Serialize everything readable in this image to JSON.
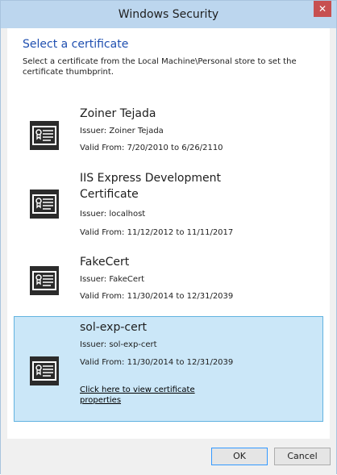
{
  "window": {
    "title": "Windows Security",
    "close_label": "✕"
  },
  "header": {
    "title": "Select a certificate",
    "description": "Select a certificate from the Local Machine\\Personal store to set the certificate thumbprint."
  },
  "certificates": [
    {
      "name": "Zoiner Tejada",
      "issuer": "Issuer: Zoiner Tejada",
      "valid": "Valid From: 7/20/2010 to 6/26/2110",
      "selected": false
    },
    {
      "name": "IIS Express Development Certificate",
      "issuer": "Issuer: localhost",
      "valid": "Valid From: 11/12/2012 to 11/11/2017",
      "selected": false
    },
    {
      "name": "FakeCert",
      "issuer": "Issuer: FakeCert",
      "valid": "Valid From: 11/30/2014 to 12/31/2039",
      "selected": false
    },
    {
      "name": "sol-exp-cert",
      "issuer": "Issuer: sol-exp-cert",
      "valid": "Valid From: 11/30/2014 to 12/31/2039",
      "selected": true,
      "link": "Click here to view certificate properties"
    }
  ],
  "buttons": {
    "ok": "OK",
    "cancel": "Cancel"
  },
  "colors": {
    "titlebar": "#bcd6ee",
    "heading": "#1f4fb0",
    "selected_bg": "#cbe7f8",
    "selected_border": "#62b3e0",
    "close": "#c75050"
  },
  "icons": {
    "certificate": "certificate-icon"
  }
}
